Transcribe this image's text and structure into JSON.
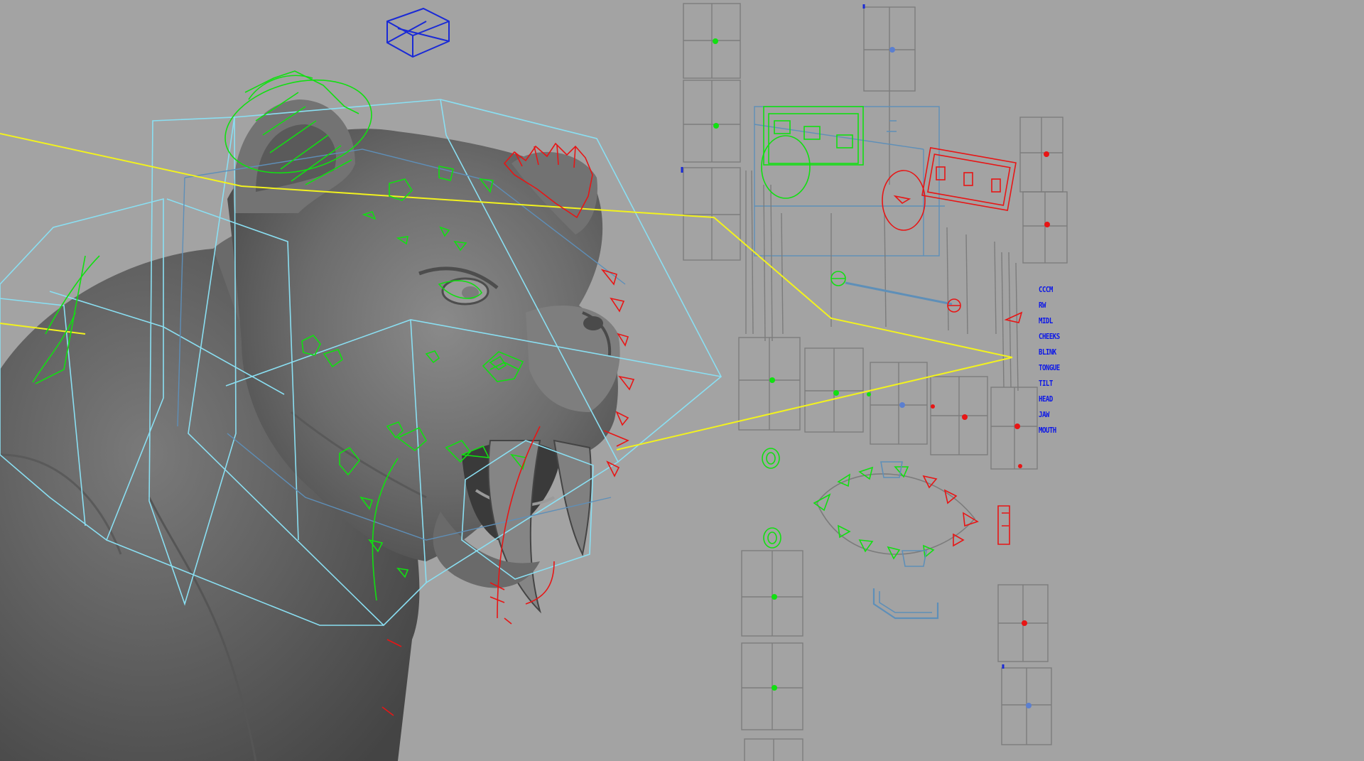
{
  "viewport": {
    "background": "#a3a3a3",
    "colors": {
      "mesh": "#6e6e6e",
      "fk_control": "#11e011",
      "ik_control": "#e81515",
      "cage": "#8adff2",
      "cage_inner": "#5e8fb8",
      "guide_line": "#f2f21e",
      "panel_lines": "#7c7c7c",
      "selected_blue": "#1a2ad6"
    },
    "icons": [
      "cube-icon",
      "face-control-board-icon",
      "sabertooth-mesh-icon"
    ]
  },
  "control_labels": [
    "CCCM",
    "RW",
    "MIDL",
    "CHEEKS",
    "BLINK",
    "TONGUE",
    "TILT",
    "HEAD",
    "JAW",
    "MOUTH"
  ]
}
